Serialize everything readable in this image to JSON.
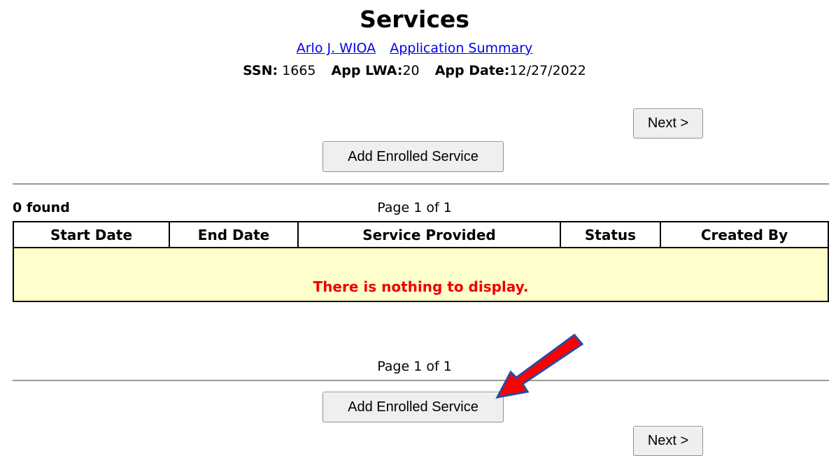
{
  "header": {
    "title": "Services",
    "participant_link": "Arlo J. WIOA",
    "summary_link": "Application Summary",
    "ssn_label": "SSN:",
    "ssn_value": "1665",
    "lwa_label": "App LWA:",
    "lwa_value": "20",
    "date_label": "App Date:",
    "date_value": "12/27/2022"
  },
  "buttons": {
    "next": "Next >",
    "add_enrolled_service": "Add Enrolled Service"
  },
  "results": {
    "found": "0 found",
    "page_info": "Page 1 of 1"
  },
  "table": {
    "columns": [
      "Start Date",
      "End Date",
      "Service Provided",
      "Status",
      "Created By"
    ],
    "empty_message": "There is nothing to display."
  },
  "annotation": {
    "arrow_color": "#ff0000",
    "arrow_outline": "#2b4aa0",
    "points_to": "add-enrolled-service-button-bottom"
  },
  "colors": {
    "link": "#0000ee",
    "empty_row_bg": "#ffffcc",
    "empty_message": "#ee0000"
  }
}
